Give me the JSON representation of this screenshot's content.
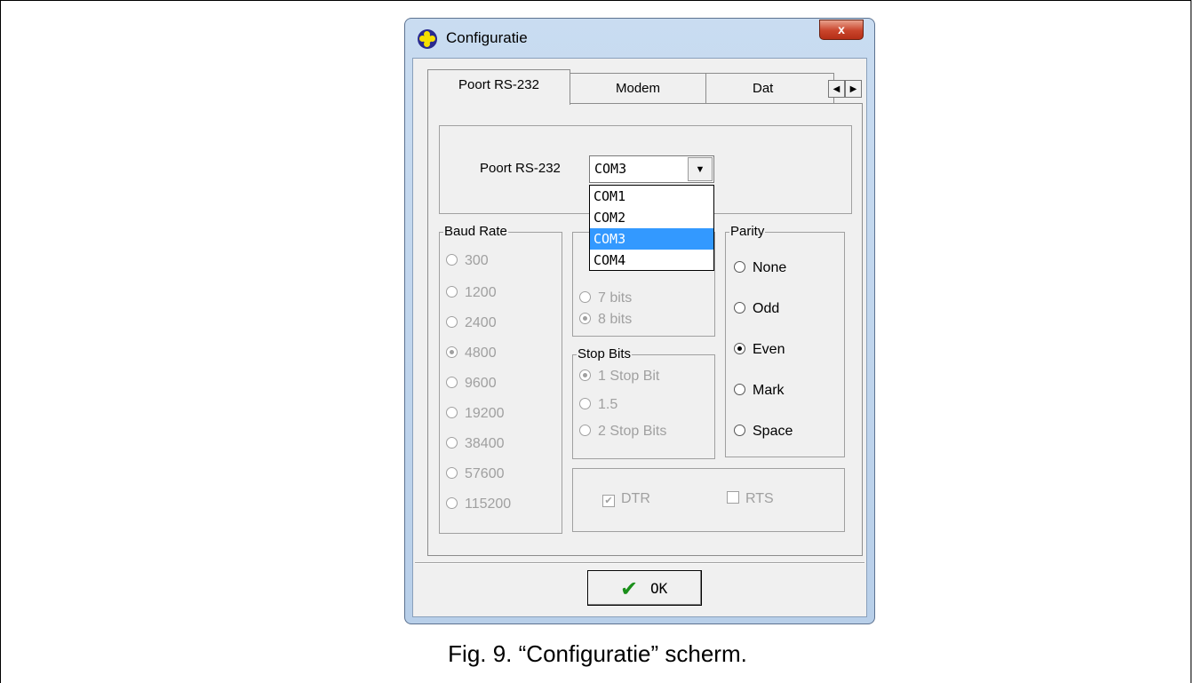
{
  "window": {
    "title": "Configuratie",
    "close_label": "x"
  },
  "tabs": [
    {
      "label": "Poort RS-232"
    },
    {
      "label": "Modem"
    },
    {
      "label": "Dat"
    }
  ],
  "tab_scroll": {
    "left": "◀",
    "right": "▶"
  },
  "port": {
    "label": "Poort RS-232",
    "selected": "COM3",
    "options": [
      "COM1",
      "COM2",
      "COM3",
      "COM4"
    ],
    "highlighted_index": 2
  },
  "baud_rate": {
    "label": "Baud Rate",
    "options": [
      "300",
      "1200",
      "2400",
      "4800",
      "9600",
      "19200",
      "38400",
      "57600",
      "115200"
    ],
    "selected": "4800"
  },
  "data_bits": {
    "options": [
      "7 bits",
      "8 bits"
    ],
    "selected": "8 bits"
  },
  "stop_bits": {
    "label": "Stop Bits",
    "options": [
      "1 Stop Bit",
      "1.5",
      "2 Stop Bits"
    ],
    "selected": "1 Stop Bit"
  },
  "parity": {
    "label": "Parity",
    "options": [
      "None",
      "Odd",
      "Even",
      "Mark",
      "Space"
    ],
    "selected": "Even"
  },
  "lines": {
    "dtr_label": "DTR",
    "dtr_checked": true,
    "rts_label": "RTS",
    "rts_checked": false
  },
  "ok_label": "OK",
  "caption": "Fig. 9. “Configuratie” scherm."
}
